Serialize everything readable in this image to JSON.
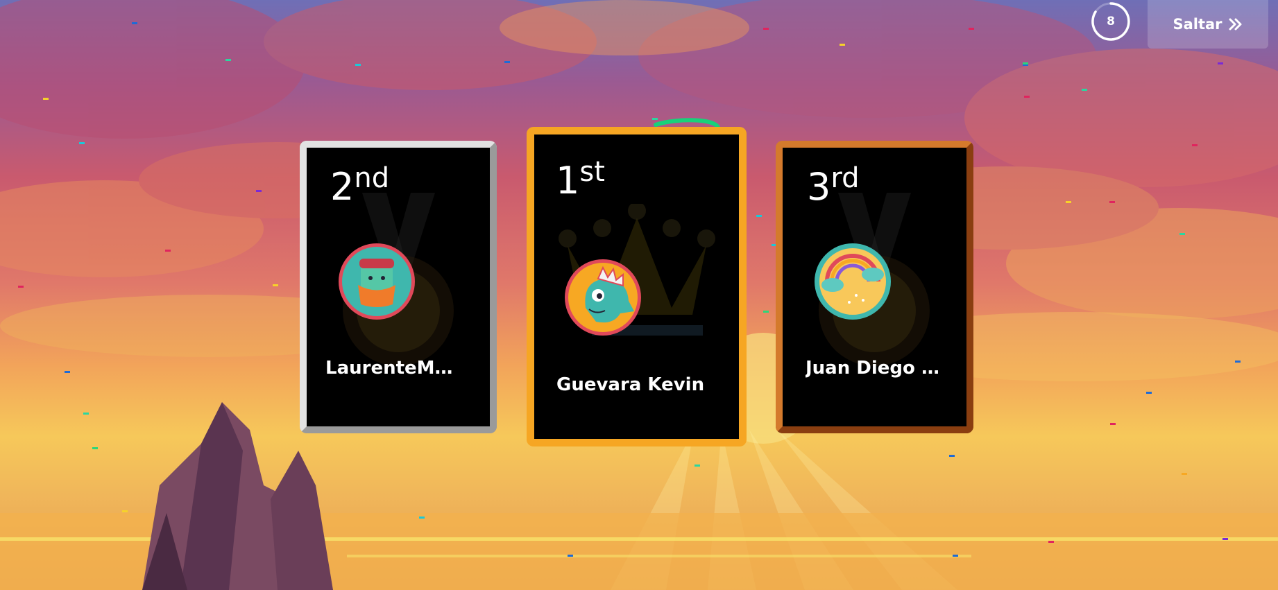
{
  "timer": {
    "value": "8"
  },
  "skip": {
    "label": "Saltar",
    "icon": "double-chevron-right-icon"
  },
  "podium": [
    {
      "rank_number": "2",
      "rank_suffix": "nd",
      "name": "LaurenteMau…",
      "avatar": "cactus-pot-avatar",
      "frame_color": "#c9c9c9"
    },
    {
      "rank_number": "1",
      "rank_suffix": "st",
      "name": "Guevara Kevin",
      "avatar": "dinosaur-avatar",
      "frame_color": "#f6a623"
    },
    {
      "rank_number": "3",
      "rank_suffix": "rd",
      "name": "Juan Diego P…",
      "avatar": "rainbow-cloud-avatar",
      "frame_color": "#c2651f"
    }
  ]
}
